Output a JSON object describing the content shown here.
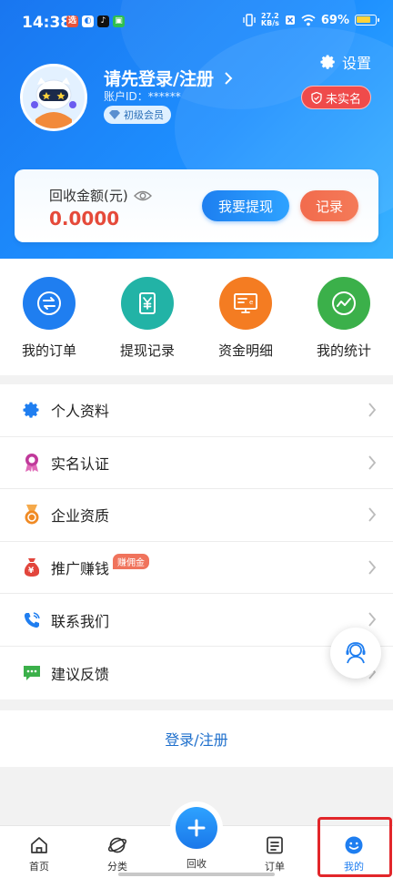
{
  "status_bar": {
    "time": "14:38",
    "net_speed_value": "27.2",
    "net_speed_unit": "KB/s",
    "battery": "69%"
  },
  "header": {
    "settings_label": "设置",
    "login_title": "请先登录/注册",
    "account_id": "账户ID：******",
    "member_level": "初级会员",
    "verify_status": "未实名"
  },
  "money_card": {
    "label": "回收金额(元)",
    "value": "0.0000",
    "withdraw_button": "我要提现",
    "record_button": "记录"
  },
  "quick_actions": [
    {
      "label": "我的订单",
      "icon": "exchange-icon",
      "color": "#1f7ef0"
    },
    {
      "label": "提现记录",
      "icon": "yuan-receipt-icon",
      "color": "#22b3a6"
    },
    {
      "label": "资金明细",
      "icon": "monitor-icon",
      "color": "#f47c22"
    },
    {
      "label": "我的统计",
      "icon": "chart-line-icon",
      "color": "#3bb04a"
    }
  ],
  "menu": [
    {
      "label": "个人资料",
      "icon": "gear-icon",
      "color": "#1f7ef0"
    },
    {
      "label": "实名认证",
      "icon": "badge-icon",
      "color": "#c0399a"
    },
    {
      "label": "企业资质",
      "icon": "medal-icon",
      "color": "#f08a24"
    },
    {
      "label": "推广赚钱",
      "icon": "money-bag-icon",
      "color": "#e2453c",
      "badge": "赚佣金"
    },
    {
      "label": "联系我们",
      "icon": "phone-icon",
      "color": "#1f7ef0"
    },
    {
      "label": "建议反馈",
      "icon": "message-icon",
      "color": "#3bb04a"
    }
  ],
  "login_link": "登录/注册",
  "tabbar": {
    "home": "首页",
    "category": "分类",
    "recycle": "回收",
    "orders": "订单",
    "mine": "我的",
    "active_color": "#1f7ef0"
  }
}
